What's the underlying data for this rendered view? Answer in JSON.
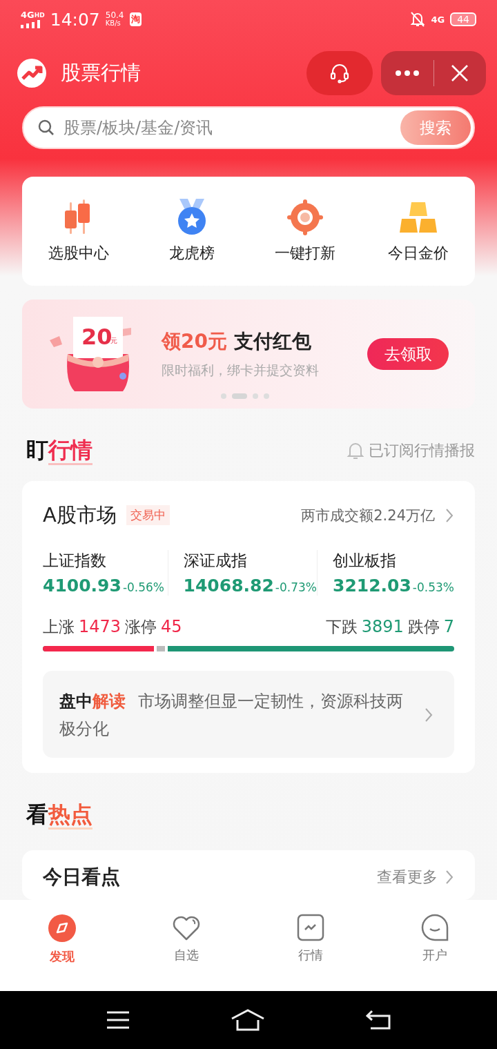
{
  "status_bar": {
    "network": "4G",
    "network_badge": "HD",
    "time": "14:07",
    "speed": "50.4",
    "speed_unit": "KB/s",
    "app_badge": "淘",
    "cell": "4G",
    "battery": "44"
  },
  "header": {
    "title": "股票行情"
  },
  "search": {
    "placeholder": "股票/板块/基金/资讯",
    "button": "搜索"
  },
  "shortcuts": [
    {
      "label": "选股中心",
      "kind": "candles"
    },
    {
      "label": "龙虎榜",
      "kind": "medal"
    },
    {
      "label": "一键打新",
      "kind": "target"
    },
    {
      "label": "今日金价",
      "kind": "gold"
    }
  ],
  "banner": {
    "amount": "20",
    "unit": "元",
    "title_accent": "领20元",
    "title": "支付红包",
    "subtitle": "限时福利，绑卡并提交资料",
    "button": "去领取",
    "dots": [
      {
        "selected": false
      },
      {
        "selected": true
      },
      {
        "selected": false
      },
      {
        "selected": false
      }
    ]
  },
  "watch_section": {
    "lead": "盯",
    "accent": "行情",
    "subscribe": "已订阅行情播报"
  },
  "market": {
    "title": "A股市场",
    "status": "交易中",
    "turnover": "两市成交额2.24万亿",
    "indices": [
      {
        "name": "上证指数",
        "value": "4100.93",
        "change": "-0.56%",
        "color": "#1f9a74"
      },
      {
        "name": "深证成指",
        "value": "14068.82",
        "change": "-0.73%",
        "color": "#1f9a74"
      },
      {
        "name": "创业板指",
        "value": "3212.03",
        "change": "-0.53%",
        "color": "#1f9a74"
      }
    ],
    "stats_left": [
      {
        "label": "上涨",
        "value": "1473",
        "color": "#f0284a"
      },
      {
        "label": "涨停",
        "value": "45",
        "color": "#f0284a"
      }
    ],
    "stats_right": [
      {
        "label": "下跌",
        "value": "3891",
        "color": "#1f9a74"
      },
      {
        "label": "跌停",
        "value": "7",
        "color": "#1f9a74"
      }
    ],
    "breadth": {
      "level": 0.27
    },
    "insight": {
      "lead": "盘中",
      "accent": "解读",
      "text": "市场调整但显一定韧性，资源科技两极分化"
    }
  },
  "hot_section": {
    "lead": "看",
    "accent": "热点"
  },
  "today": {
    "title": "今日看点",
    "more": "查看更多"
  },
  "tab_bar": [
    {
      "label": "发现",
      "kind": "discover",
      "selected": true
    },
    {
      "label": "自选",
      "kind": "heart",
      "selected": false
    },
    {
      "label": "行情",
      "kind": "chart",
      "selected": false
    },
    {
      "label": "开户",
      "kind": "chat",
      "selected": false
    }
  ]
}
